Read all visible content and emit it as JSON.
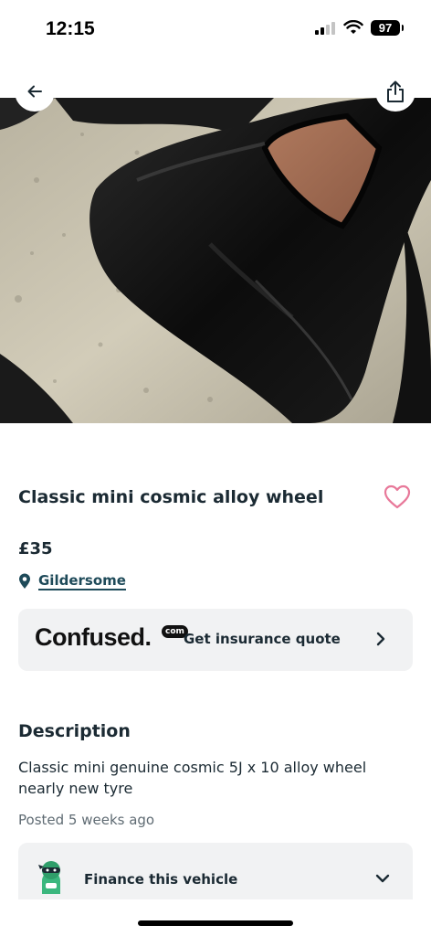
{
  "status_bar": {
    "time": "12:15",
    "battery": "97"
  },
  "listing": {
    "title": "Classic mini cosmic alloy wheel",
    "price": "£35",
    "location": "Gildersome"
  },
  "insurance": {
    "brand": "Confused.",
    "brand_suffix": "com",
    "label": "Get insurance quote"
  },
  "description": {
    "heading": "Description",
    "body": "Classic mini genuine cosmic 5J x 10 alloy wheel nearly new tyre",
    "posted": "Posted 5 weeks ago"
  },
  "finance": {
    "label": "Finance this vehicle"
  },
  "colors": {
    "accent_heart": "#e8799a",
    "link": "#1e4a59",
    "card_bg": "#f1f2f3",
    "finance_green": "#3bb77e"
  },
  "icons": {
    "back": "arrow-left-icon",
    "share": "share-icon",
    "favorite": "heart-outline-icon",
    "location": "map-pin-icon",
    "chevron_right": "chevron-right-icon",
    "chevron_down": "chevron-down-icon",
    "finance": "ninja-mascot-icon"
  }
}
